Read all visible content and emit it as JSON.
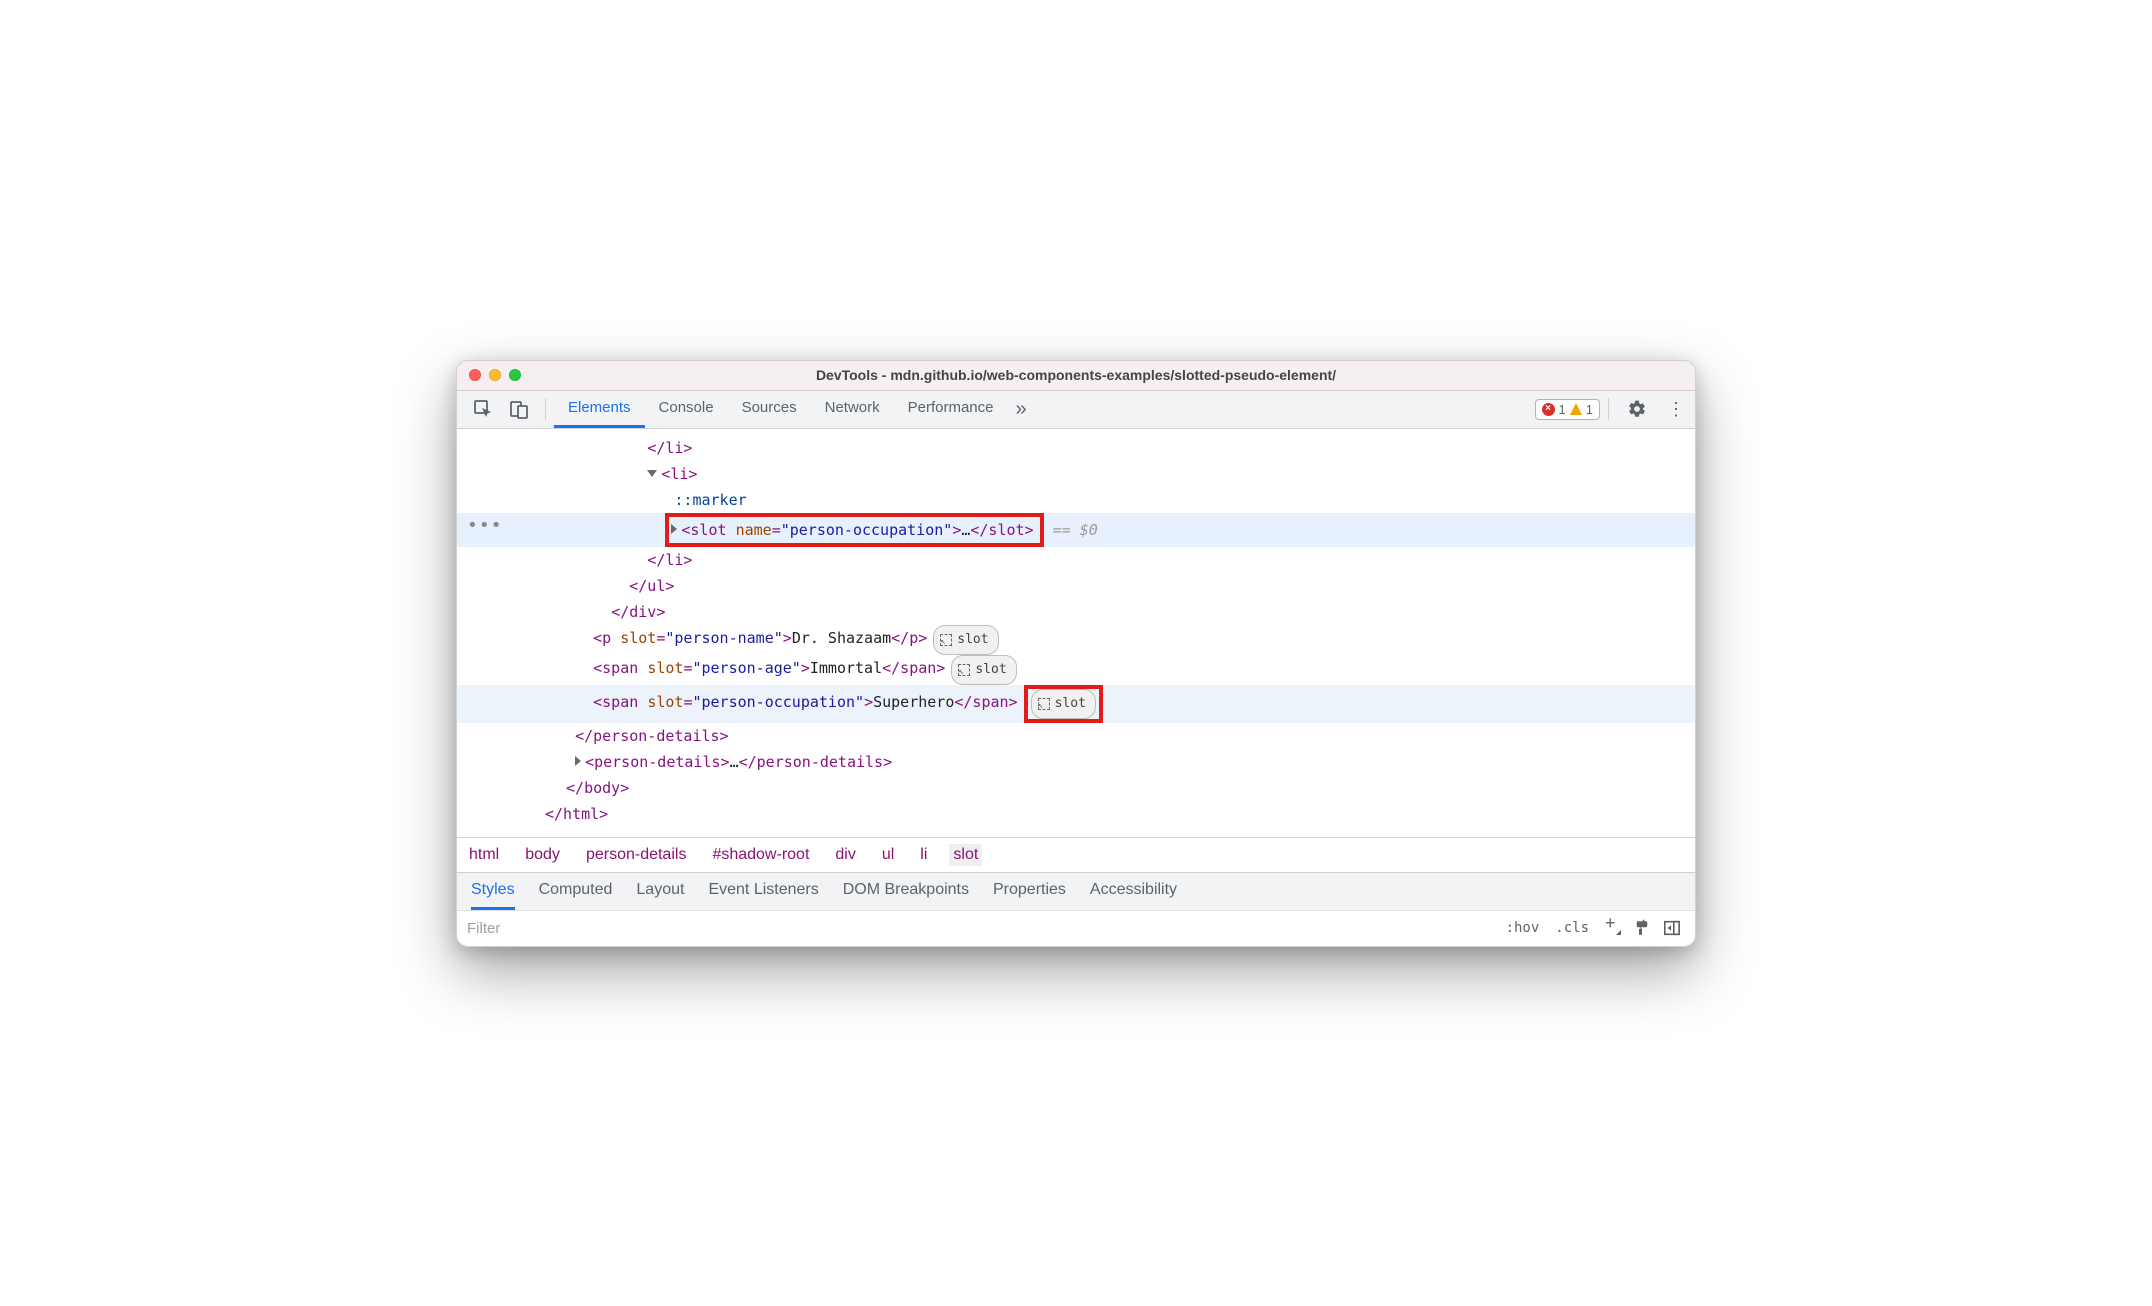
{
  "window_title": "DevTools - mdn.github.io/web-components-examples/slotted-pseudo-element/",
  "tabs": {
    "elements": "Elements",
    "console": "Console",
    "sources": "Sources",
    "network": "Network",
    "performance": "Performance"
  },
  "issues": {
    "errors": "1",
    "warnings": "1"
  },
  "tree": {
    "li_close": "</li>",
    "li_open": "<li>",
    "marker": "::marker",
    "slot_open_tag": "slot",
    "slot_attr_name": "name",
    "slot_attr_value": "\"person-occupation\"",
    "slot_ell": "…",
    "slot_close": "</slot>",
    "eq0": "== $0",
    "ul_close": "</ul>",
    "div_close": "</div>",
    "p_tag": "p",
    "p_attr_name": "slot",
    "p_attr_value": "\"person-name\"",
    "p_text": "Dr. Shazaam",
    "p_close": "</p>",
    "span1_tag": "span",
    "span1_attr_name": "slot",
    "span1_attr_value": "\"person-age\"",
    "span1_text": "Immortal",
    "span1_close": "</span>",
    "span2_tag": "span",
    "span2_attr_name": "slot",
    "span2_attr_value": "\"person-occupation\"",
    "span2_text": "Superhero",
    "span2_close": "</span>",
    "pd_close": "</person-details>",
    "pd2_open": "<person-details>",
    "pd2_ell": "…",
    "pd2_close": "</person-details>",
    "body_close": "</body>",
    "html_close": "</html>",
    "slot_badge": "slot"
  },
  "crumbs": [
    "html",
    "body",
    "person-details",
    "#shadow-root",
    "div",
    "ul",
    "li",
    "slot"
  ],
  "style_tabs": [
    "Styles",
    "Computed",
    "Layout",
    "Event Listeners",
    "DOM Breakpoints",
    "Properties",
    "Accessibility"
  ],
  "filter": {
    "placeholder": "Filter",
    "hov": ":hov",
    "cls": ".cls"
  }
}
